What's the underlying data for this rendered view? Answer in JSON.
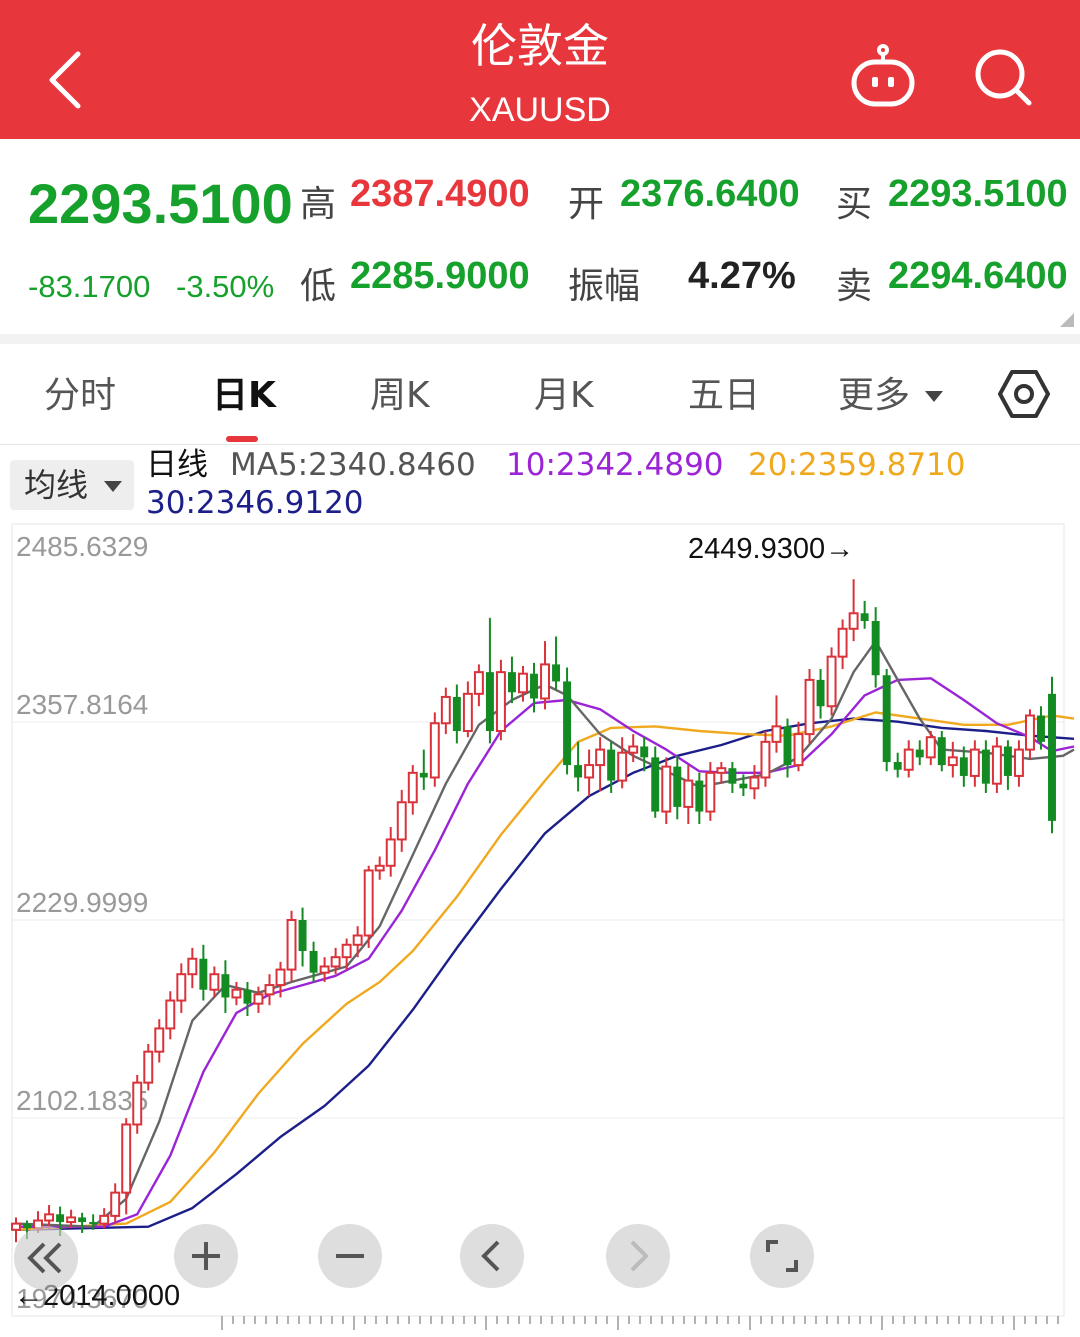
{
  "header": {
    "title": "伦敦金",
    "subtitle": "XAUUSD"
  },
  "quote": {
    "price": "2293.5100",
    "change": "-83.1700",
    "change_pct": "-3.50%",
    "high_label": "高",
    "high": "2387.4900",
    "low_label": "低",
    "low": "2285.9000",
    "open_label": "开",
    "open": "2376.6400",
    "amp_label": "振幅",
    "amplitude": "4.27%",
    "buy_label": "买",
    "buy": "2293.5100",
    "sell_label": "卖",
    "sell": "2294.6400"
  },
  "tabs": [
    {
      "label": "分时",
      "active": false
    },
    {
      "label": "日K",
      "active": true
    },
    {
      "label": "周K",
      "active": false
    },
    {
      "label": "月K",
      "active": false
    },
    {
      "label": "五日",
      "active": false
    },
    {
      "label": "更多",
      "active": false
    }
  ],
  "ma": {
    "selector": "均线",
    "line_label": "日线",
    "ma5": "MA5:2340.8460",
    "ma10": "10:2342.4890",
    "ma20": "20:2359.8710",
    "ma30": "30:2346.9120",
    "colors": {
      "ma5": "#666666",
      "ma10": "#9b24d6",
      "ma20": "#f0a91e",
      "ma30": "#1c1f8a",
      "up": "#d9323a",
      "down": "#138a22"
    }
  },
  "icons": [
    "back-arrow-icon",
    "robot-icon",
    "search-icon",
    "settings-hexagon-icon",
    "double-left-icon",
    "plus-icon",
    "minus-icon",
    "left-icon",
    "right-icon",
    "fullscreen-icon"
  ],
  "chart_data": {
    "type": "candlestick",
    "y_ticks": [
      "2485.6329",
      "2357.8164",
      "2229.9999",
      "2102.1835",
      "1974.3670"
    ],
    "ylim": [
      1974.367,
      2485.6329
    ],
    "max_label": "2449.9300→",
    "min_label": "←2014.0000",
    "candles": [
      [
        2030,
        2034,
        2022,
        2038
      ],
      [
        2034,
        2031,
        2024,
        2036
      ],
      [
        2031,
        2036,
        2028,
        2042
      ],
      [
        2036,
        2040,
        2030,
        2046
      ],
      [
        2040,
        2035,
        2026,
        2045
      ],
      [
        2035,
        2038,
        2031,
        2043
      ],
      [
        2038,
        2035,
        2028,
        2041
      ],
      [
        2035,
        2034,
        2030,
        2040
      ],
      [
        2034,
        2039,
        2031,
        2044
      ],
      [
        2039,
        2054,
        2034,
        2060
      ],
      [
        2054,
        2098,
        2040,
        2102
      ],
      [
        2098,
        2125,
        2092,
        2130
      ],
      [
        2125,
        2145,
        2120,
        2150
      ],
      [
        2145,
        2160,
        2138,
        2166
      ],
      [
        2160,
        2178,
        2153,
        2184
      ],
      [
        2178,
        2195,
        2170,
        2202
      ],
      [
        2195,
        2205,
        2186,
        2212
      ],
      [
        2205,
        2185,
        2178,
        2214
      ],
      [
        2185,
        2195,
        2180,
        2200
      ],
      [
        2195,
        2180,
        2170,
        2204
      ],
      [
        2180,
        2185,
        2175,
        2190
      ],
      [
        2185,
        2176,
        2168,
        2190
      ],
      [
        2176,
        2182,
        2170,
        2187
      ],
      [
        2182,
        2188,
        2175,
        2195
      ],
      [
        2188,
        2198,
        2180,
        2203
      ],
      [
        2198,
        2230,
        2190,
        2236
      ],
      [
        2230,
        2210,
        2200,
        2238
      ],
      [
        2210,
        2196,
        2190,
        2216
      ],
      [
        2196,
        2200,
        2190,
        2206
      ],
      [
        2200,
        2206,
        2195,
        2212
      ],
      [
        2206,
        2214,
        2198,
        2218
      ],
      [
        2214,
        2220,
        2206,
        2226
      ],
      [
        2220,
        2262,
        2212,
        2265
      ],
      [
        2262,
        2265,
        2256,
        2271
      ],
      [
        2265,
        2282,
        2258,
        2290
      ],
      [
        2282,
        2306,
        2274,
        2314
      ],
      [
        2306,
        2325,
        2298,
        2330
      ],
      [
        2325,
        2322,
        2314,
        2340
      ],
      [
        2322,
        2357,
        2316,
        2364
      ],
      [
        2357,
        2374,
        2350,
        2380
      ],
      [
        2374,
        2352,
        2344,
        2382
      ],
      [
        2352,
        2376,
        2348,
        2384
      ],
      [
        2376,
        2390,
        2368,
        2395
      ],
      [
        2390,
        2352,
        2344,
        2425
      ],
      [
        2352,
        2390,
        2346,
        2398
      ],
      [
        2390,
        2377,
        2370,
        2400
      ],
      [
        2377,
        2389,
        2371,
        2394
      ],
      [
        2389,
        2373,
        2364,
        2396
      ],
      [
        2373,
        2395,
        2366,
        2410
      ],
      [
        2395,
        2384,
        2379,
        2413
      ],
      [
        2384,
        2330,
        2324,
        2393
      ],
      [
        2330,
        2322,
        2313,
        2345
      ],
      [
        2322,
        2330,
        2310,
        2340
      ],
      [
        2330,
        2340,
        2313,
        2348
      ],
      [
        2340,
        2320,
        2312,
        2345
      ],
      [
        2320,
        2338,
        2315,
        2348
      ],
      [
        2338,
        2342,
        2332,
        2350
      ],
      [
        2342,
        2335,
        2326,
        2348
      ],
      [
        2335,
        2300,
        2296,
        2342
      ],
      [
        2300,
        2329,
        2292,
        2335
      ],
      [
        2329,
        2303,
        2295,
        2336
      ],
      [
        2303,
        2320,
        2292,
        2330
      ],
      [
        2320,
        2300,
        2292,
        2325
      ],
      [
        2300,
        2325,
        2294,
        2332
      ],
      [
        2325,
        2328,
        2318,
        2332
      ],
      [
        2328,
        2318,
        2312,
        2332
      ],
      [
        2318,
        2315,
        2310,
        2324
      ],
      [
        2315,
        2322,
        2308,
        2330
      ],
      [
        2322,
        2345,
        2316,
        2352
      ],
      [
        2345,
        2355,
        2338,
        2375
      ],
      [
        2355,
        2330,
        2322,
        2360
      ],
      [
        2330,
        2350,
        2326,
        2358
      ],
      [
        2350,
        2385,
        2344,
        2392
      ],
      [
        2385,
        2368,
        2360,
        2392
      ],
      [
        2368,
        2400,
        2362,
        2406
      ],
      [
        2400,
        2418,
        2392,
        2424
      ],
      [
        2418,
        2428,
        2410,
        2450
      ],
      [
        2428,
        2423,
        2418,
        2436
      ],
      [
        2423,
        2388,
        2380,
        2432
      ],
      [
        2388,
        2332,
        2326,
        2392
      ],
      [
        2332,
        2327,
        2322,
        2338
      ],
      [
        2327,
        2340,
        2322,
        2346
      ],
      [
        2340,
        2335,
        2330,
        2346
      ],
      [
        2335,
        2348,
        2330,
        2352
      ],
      [
        2348,
        2330,
        2326,
        2352
      ],
      [
        2330,
        2335,
        2322,
        2345
      ],
      [
        2335,
        2323,
        2316,
        2342
      ],
      [
        2323,
        2340,
        2316,
        2346
      ],
      [
        2340,
        2318,
        2312,
        2346
      ],
      [
        2318,
        2342,
        2312,
        2348
      ],
      [
        2342,
        2323,
        2314,
        2346
      ],
      [
        2323,
        2340,
        2316,
        2346
      ],
      [
        2340,
        2362,
        2334,
        2366
      ],
      [
        2362,
        2345,
        2340,
        2368
      ],
      [
        2376,
        2294,
        2286,
        2387
      ]
    ],
    "ma5": [
      [
        0,
        2034
      ],
      [
        7,
        2032
      ],
      [
        10,
        2050
      ],
      [
        13,
        2100
      ],
      [
        16,
        2165
      ],
      [
        19,
        2188
      ],
      [
        22,
        2183
      ],
      [
        25,
        2190
      ],
      [
        28,
        2196
      ],
      [
        30,
        2200
      ],
      [
        33,
        2226
      ],
      [
        36,
        2272
      ],
      [
        39,
        2318
      ],
      [
        42,
        2356
      ],
      [
        45,
        2372
      ],
      [
        48,
        2382
      ],
      [
        50,
        2375
      ],
      [
        53,
        2350
      ],
      [
        56,
        2336
      ],
      [
        59,
        2326
      ],
      [
        62,
        2316
      ],
      [
        65,
        2320
      ],
      [
        68,
        2324
      ],
      [
        71,
        2335
      ],
      [
        74,
        2360
      ],
      [
        76,
        2390
      ],
      [
        78,
        2410
      ],
      [
        80,
        2385
      ],
      [
        82,
        2360
      ],
      [
        84,
        2340
      ],
      [
        88,
        2338
      ],
      [
        92,
        2334
      ],
      [
        95,
        2336
      ],
      [
        96,
        2340
      ]
    ],
    "ma10": [
      [
        0,
        2032
      ],
      [
        8,
        2032
      ],
      [
        11,
        2040
      ],
      [
        14,
        2078
      ],
      [
        17,
        2132
      ],
      [
        20,
        2170
      ],
      [
        23,
        2182
      ],
      [
        26,
        2188
      ],
      [
        29,
        2194
      ],
      [
        32,
        2205
      ],
      [
        35,
        2236
      ],
      [
        38,
        2275
      ],
      [
        41,
        2318
      ],
      [
        44,
        2352
      ],
      [
        47,
        2370
      ],
      [
        50,
        2372
      ],
      [
        53,
        2366
      ],
      [
        56,
        2352
      ],
      [
        59,
        2340
      ],
      [
        62,
        2326
      ],
      [
        65,
        2325
      ],
      [
        68,
        2325
      ],
      [
        71,
        2330
      ],
      [
        74,
        2350
      ],
      [
        77,
        2375
      ],
      [
        80,
        2385
      ],
      [
        83,
        2386
      ],
      [
        86,
        2372
      ],
      [
        89,
        2357
      ],
      [
        92,
        2348
      ],
      [
        94,
        2339
      ],
      [
        96,
        2342
      ]
    ],
    "ma20": [
      [
        0,
        2030
      ],
      [
        10,
        2034
      ],
      [
        14,
        2048
      ],
      [
        18,
        2080
      ],
      [
        22,
        2118
      ],
      [
        26,
        2150
      ],
      [
        30,
        2176
      ],
      [
        33,
        2190
      ],
      [
        36,
        2210
      ],
      [
        40,
        2245
      ],
      [
        44,
        2285
      ],
      [
        48,
        2320
      ],
      [
        51,
        2345
      ],
      [
        54,
        2354
      ],
      [
        58,
        2355
      ],
      [
        62,
        2352
      ],
      [
        66,
        2350
      ],
      [
        70,
        2349
      ],
      [
        74,
        2355
      ],
      [
        78,
        2364
      ],
      [
        82,
        2360
      ],
      [
        86,
        2356
      ],
      [
        90,
        2356
      ],
      [
        94,
        2362
      ],
      [
        96,
        2360
      ]
    ],
    "ma30": [
      [
        0,
        2030
      ],
      [
        12,
        2032
      ],
      [
        16,
        2044
      ],
      [
        20,
        2066
      ],
      [
        24,
        2090
      ],
      [
        28,
        2110
      ],
      [
        32,
        2136
      ],
      [
        36,
        2172
      ],
      [
        40,
        2212
      ],
      [
        44,
        2250
      ],
      [
        48,
        2286
      ],
      [
        52,
        2310
      ],
      [
        56,
        2325
      ],
      [
        60,
        2336
      ],
      [
        64,
        2343
      ],
      [
        68,
        2352
      ],
      [
        72,
        2357
      ],
      [
        76,
        2360
      ],
      [
        80,
        2358
      ],
      [
        84,
        2354
      ],
      [
        88,
        2352
      ],
      [
        92,
        2349
      ],
      [
        96,
        2347
      ]
    ]
  }
}
